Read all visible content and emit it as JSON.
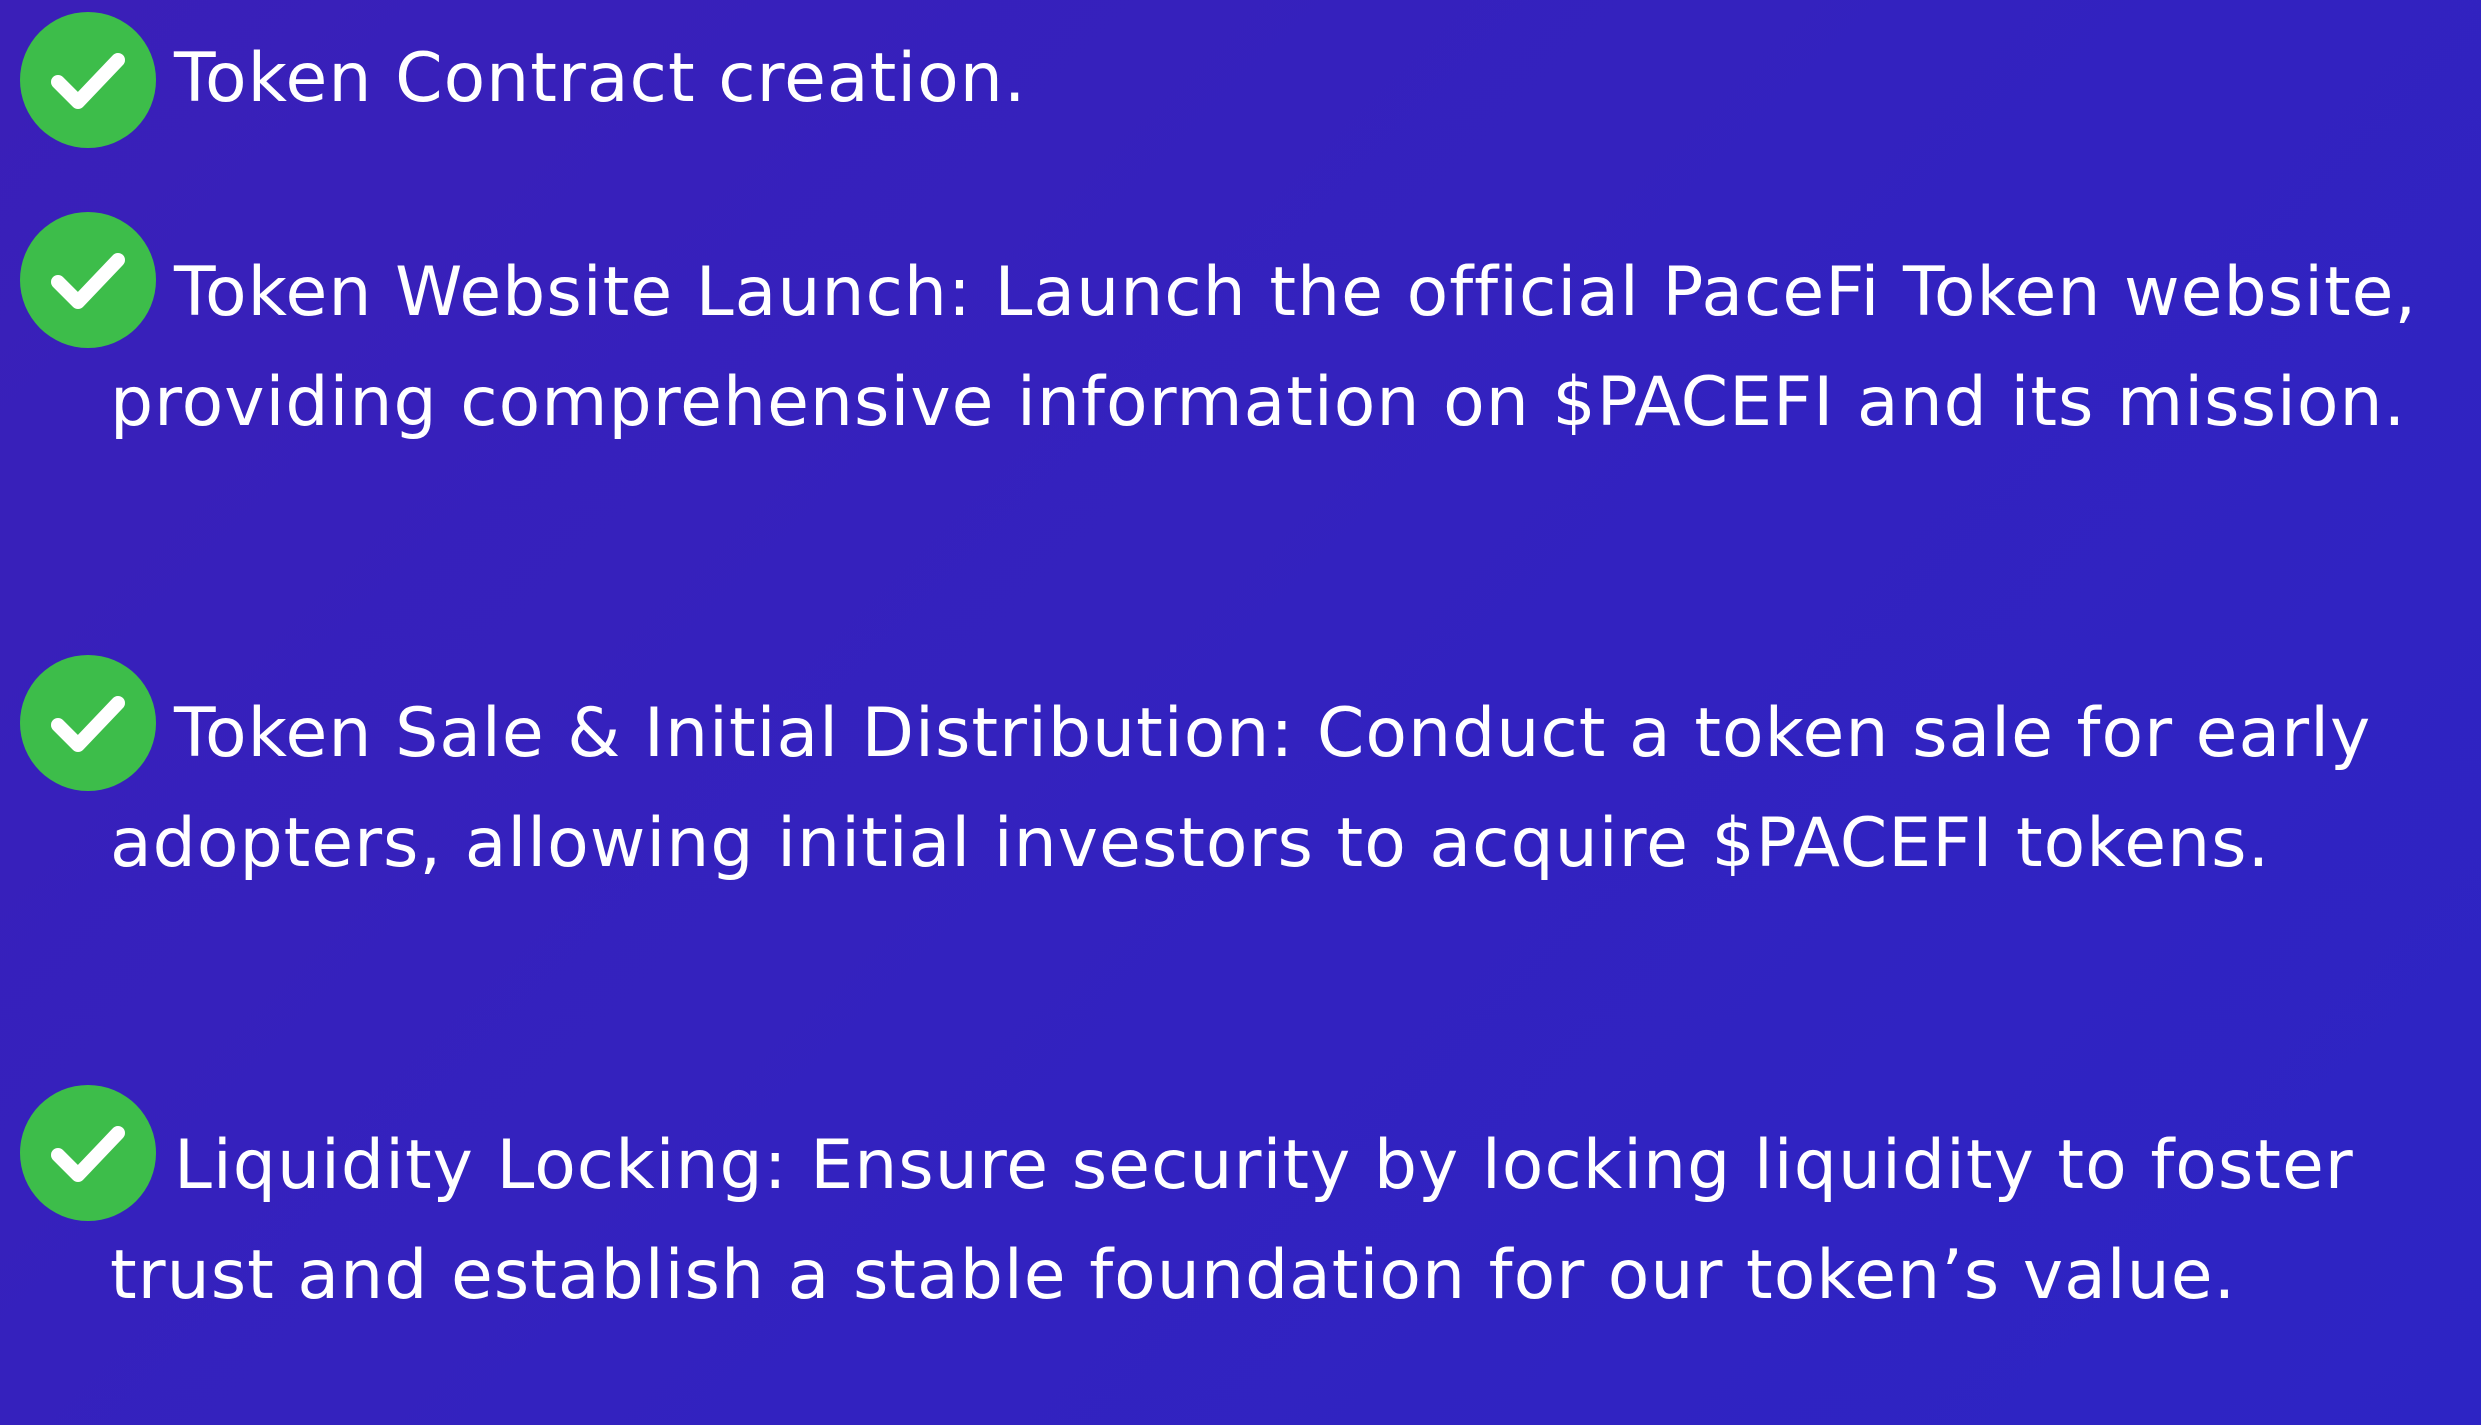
{
  "colors": {
    "background_start": "#3a1fb8",
    "background_end": "#2d24c4",
    "check_circle": "#3dbd4a",
    "check_mark": "#ffffff",
    "text": "#ffffff"
  },
  "icons": {
    "check": "check-circle-icon"
  },
  "items": [
    {
      "text": "Token Contract creation."
    },
    {
      "text": "Token Website Launch: Launch the official PaceFi Token website, providing comprehensive information on $PACEFI and its mission."
    },
    {
      "text": "Token Sale & Initial Distribution: Conduct a token sale for early adopters, allowing initial investors to acquire $PACEFI tokens."
    },
    {
      "text": "Liquidity Locking: Ensure security by locking liquidity to foster trust and establish a stable foundation for our token’s value."
    }
  ]
}
